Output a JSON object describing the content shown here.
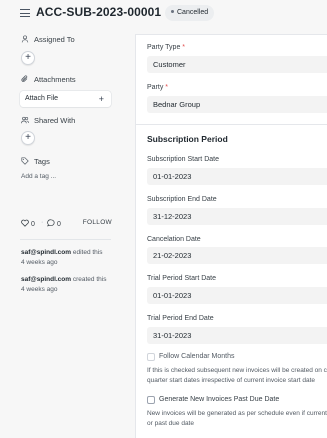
{
  "header": {
    "title": "ACC-SUB-2023-00001",
    "status": "Cancelled"
  },
  "sidebar": {
    "assigned_to": "Assigned To",
    "attachments": "Attachments",
    "attach_file": "Attach File",
    "shared_with": "Shared With",
    "tags": "Tags",
    "add_tag": "Add a tag ...",
    "likes": "0",
    "comments": "0",
    "follow": "FOLLOW",
    "activity": [
      {
        "user": "saf@spindl.com",
        "action": "edited this",
        "time": "4 weeks ago"
      },
      {
        "user": "saf@spindl.com",
        "action": "created this",
        "time": "4 weeks ago"
      }
    ]
  },
  "form": {
    "party_type": {
      "label": "Party Type",
      "value": "Customer"
    },
    "party": {
      "label": "Party",
      "value": "Bednar Group"
    },
    "section_title": "Subscription Period",
    "start_date": {
      "label": "Subscription Start Date",
      "value": "01-01-2023"
    },
    "end_date": {
      "label": "Subscription End Date",
      "value": "31-12-2023"
    },
    "cancelation_date": {
      "label": "Cancelation Date",
      "value": "21-02-2023"
    },
    "trial_start": {
      "label": "Trial Period Start Date",
      "value": "01-01-2023"
    },
    "trial_end": {
      "label": "Trial Period End Date",
      "value": "31-01-2023"
    },
    "follow_calendar": {
      "label": "Follow Calendar Months",
      "description": "If this is checked subsequent new invoices will be created on calendar month and quarter start dates irrespective of current invoice start date",
      "checked": false
    },
    "past_due": {
      "label": "Generate New Invoices Past Due Date",
      "description": "New invoices will be generated as per schedule even if current invoices are unpaid or past due date",
      "checked": false
    }
  }
}
